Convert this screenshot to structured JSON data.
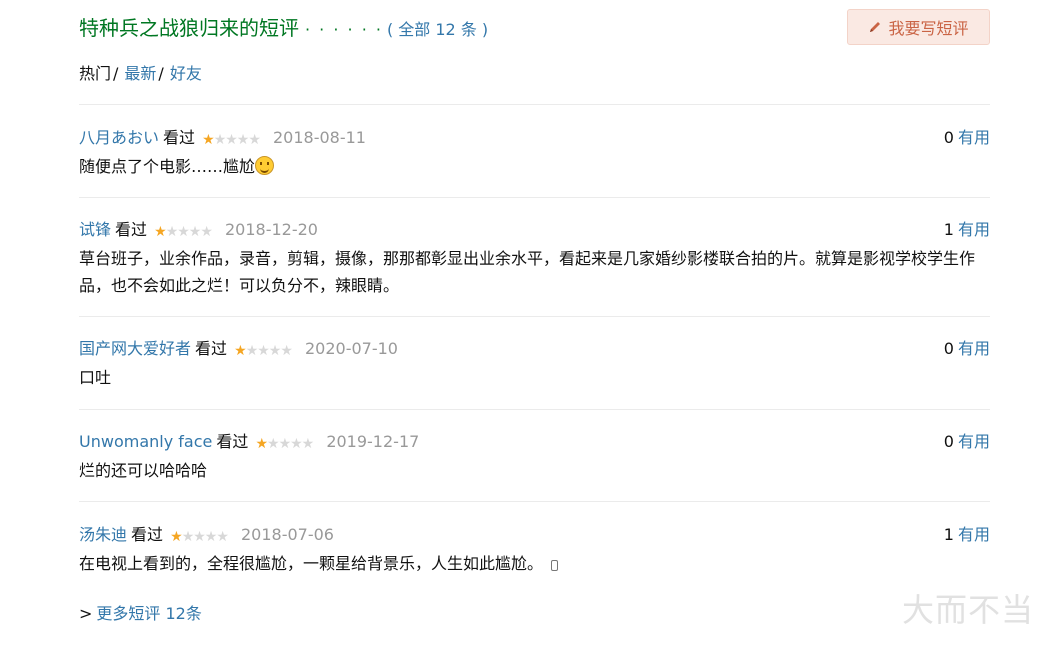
{
  "header": {
    "title": "特种兵之战狼归来的短评",
    "dots": "· · · · · ·",
    "total": "( 全部 12 条 )",
    "write_button": "我要写短评"
  },
  "tabs": [
    {
      "label": "热门",
      "sep": "/"
    },
    {
      "label": "最新",
      "sep": "/"
    },
    {
      "label": "好友",
      "sep": ""
    }
  ],
  "comments": [
    {
      "user": "八月あおい",
      "status": "看过",
      "rating": 1,
      "stars": "★",
      "stars_off": "★★★★",
      "date": "2018-08-11",
      "votes": "0",
      "votes_label": "有用",
      "text": "随便点了个电影……尴尬"
    },
    {
      "user": "试锋",
      "status": "看过",
      "rating": 1,
      "stars": "★",
      "stars_off": "★★★★",
      "date": "2018-12-20",
      "votes": "1",
      "votes_label": "有用",
      "text": "草台班子，业余作品，录音，剪辑，摄像，那那都彰显出业余水平，看起来是几家婚纱影楼联合拍的片。就算是影视学校学生作品，也不会如此之烂！可以负分不，辣眼睛。"
    },
    {
      "user": "国产网大爱好者",
      "status": "看过",
      "rating": 1,
      "stars": "★",
      "stars_off": "★★★★",
      "date": "2020-07-10",
      "votes": "0",
      "votes_label": "有用",
      "text": "口吐"
    },
    {
      "user": "Unwomanly face",
      "status": "看过",
      "rating": 1,
      "stars": "★",
      "stars_off": "★★★★",
      "date": "2019-12-17",
      "votes": "0",
      "votes_label": "有用",
      "text": "烂的还可以哈哈哈"
    },
    {
      "user": "汤朱迪",
      "status": "看过",
      "rating": 1,
      "stars": "★",
      "stars_off": "★★★★",
      "date": "2018-07-06",
      "votes": "1",
      "votes_label": "有用",
      "text": "在电视上看到的，全程很尴尬，一颗星给背景乐，人生如此尴尬。"
    }
  ],
  "more": {
    "arrow": ">",
    "label": "更多短评 12条"
  },
  "watermark": "大而不当",
  "colors": {
    "title": "#007722",
    "link": "#3377aa",
    "star_on": "#f5a623",
    "star_off": "#d8d8d8",
    "button_bg": "#fae9e3"
  }
}
